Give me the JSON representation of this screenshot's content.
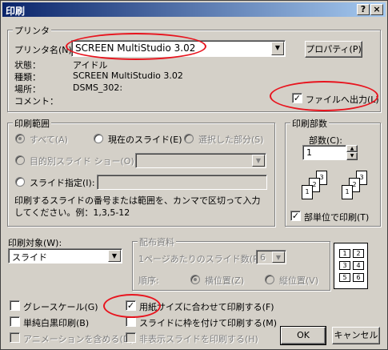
{
  "window": {
    "title": "印刷",
    "help_btn": "?",
    "close_btn": "×"
  },
  "printer": {
    "group_label": "プリンタ",
    "name_label": "プリンタ名(N):",
    "name_value": "SCREEN MultiStudio 3.02",
    "properties_btn": "プロパティ(P)",
    "status_label": "状態：",
    "status_value": "アイドル",
    "type_label": "種類：",
    "type_value": "SCREEN MultiStudio 3.02",
    "where_label": "場所：",
    "where_value": "DSMS_302:",
    "comment_label": "コメント：",
    "print_to_file": "ファイルへ出力(L)"
  },
  "range": {
    "group_label": "印刷範囲",
    "all": "すべて(A)",
    "current": "現在のスライド(E)",
    "selection": "選択した部分(S)",
    "custom_show": "目的別スライド ショー(O):",
    "slides": "スライド指定(I):",
    "help": "印刷するスライドの番号または範囲を、カンマで区切って入力してください。例：1,3,5-12"
  },
  "copies": {
    "group_label": "印刷部数",
    "count_label": "部数(C):",
    "count_value": "1",
    "collate": "部単位で印刷(T)"
  },
  "print_what": {
    "label": "印刷対象(W):",
    "value": "スライド"
  },
  "handouts": {
    "group_label": "配布資料",
    "per_page_label": "1ページあたりのスライド数(R):",
    "per_page_value": "6",
    "order_label": "順序:",
    "horizontal": "横位置(Z)",
    "vertical": "縦位置(V)"
  },
  "options": {
    "grayscale": "グレースケール(G)",
    "pure_bw": "単純白黒印刷(B)",
    "animations": "アニメーションを含める(D)",
    "scale_to_fit": "用紙サイズに合わせて印刷する(F)",
    "frame_slides": "スライドに枠を付けて印刷する(M)",
    "hidden_slides": "非表示スライドを印刷する(H)"
  },
  "buttons": {
    "ok": "OK",
    "cancel": "キャンセル"
  },
  "copies_pages": [
    "1",
    "2",
    "3"
  ],
  "handout_cells": [
    "1",
    "2",
    "3",
    "4",
    "5",
    "6"
  ],
  "colors": {
    "highlight": "#e8141e",
    "title_bar": "#0a246a"
  }
}
